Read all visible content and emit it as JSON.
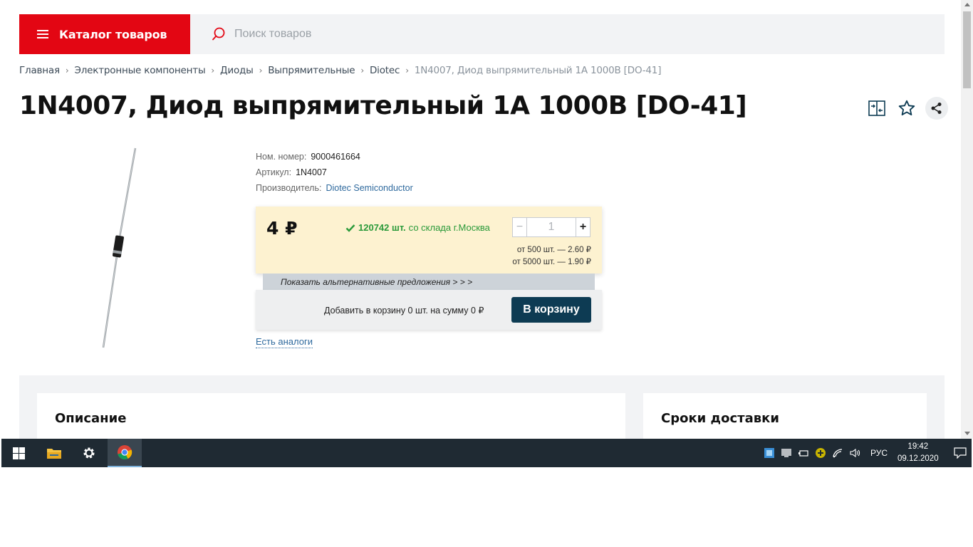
{
  "header": {
    "catalog_label": "Каталог товаров",
    "search_placeholder": "Поиск товаров"
  },
  "breadcrumb": {
    "items": [
      "Главная",
      "Электронные компоненты",
      "Диоды",
      "Выпрямительные",
      "Diotec"
    ],
    "current": "1N4007, Диод выпрямительный 1А 1000В [DO-41]"
  },
  "product": {
    "title": "1N4007, Диод выпрямительный 1А 1000В [DO-41]",
    "nom_label": "Ном. номер:",
    "nom_value": "9000461664",
    "article_label": "Артикул:",
    "article_value": "1N4007",
    "manufacturer_label": "Производитель:",
    "manufacturer_value": "Diotec Semiconductor"
  },
  "offer": {
    "price": "4 ₽",
    "stock_qty": "120742 шт.",
    "stock_source": "со склада г.Москва",
    "quantity": "1",
    "tiers": [
      "от 500 шт. — 2.60 ₽",
      "от 5000 шт. — 1.90 ₽"
    ],
    "alt_offers": "Показать альтернативные предложения > > >",
    "cart_summary": "Добавить в корзину 0 шт. на сумму 0 ₽",
    "cart_button": "В корзину",
    "analogs": "Есть аналоги"
  },
  "sections": {
    "description": "Описание",
    "delivery": "Сроки доставки"
  },
  "taskbar": {
    "lang": "РУС",
    "time": "19:42",
    "date": "09.12.2020"
  },
  "colors": {
    "brand_red": "#e30613",
    "cart_button": "#0d3b53",
    "price_card": "#fdf2d0",
    "stock_green": "#2a9a3a",
    "link_blue": "#2f6a9e"
  }
}
